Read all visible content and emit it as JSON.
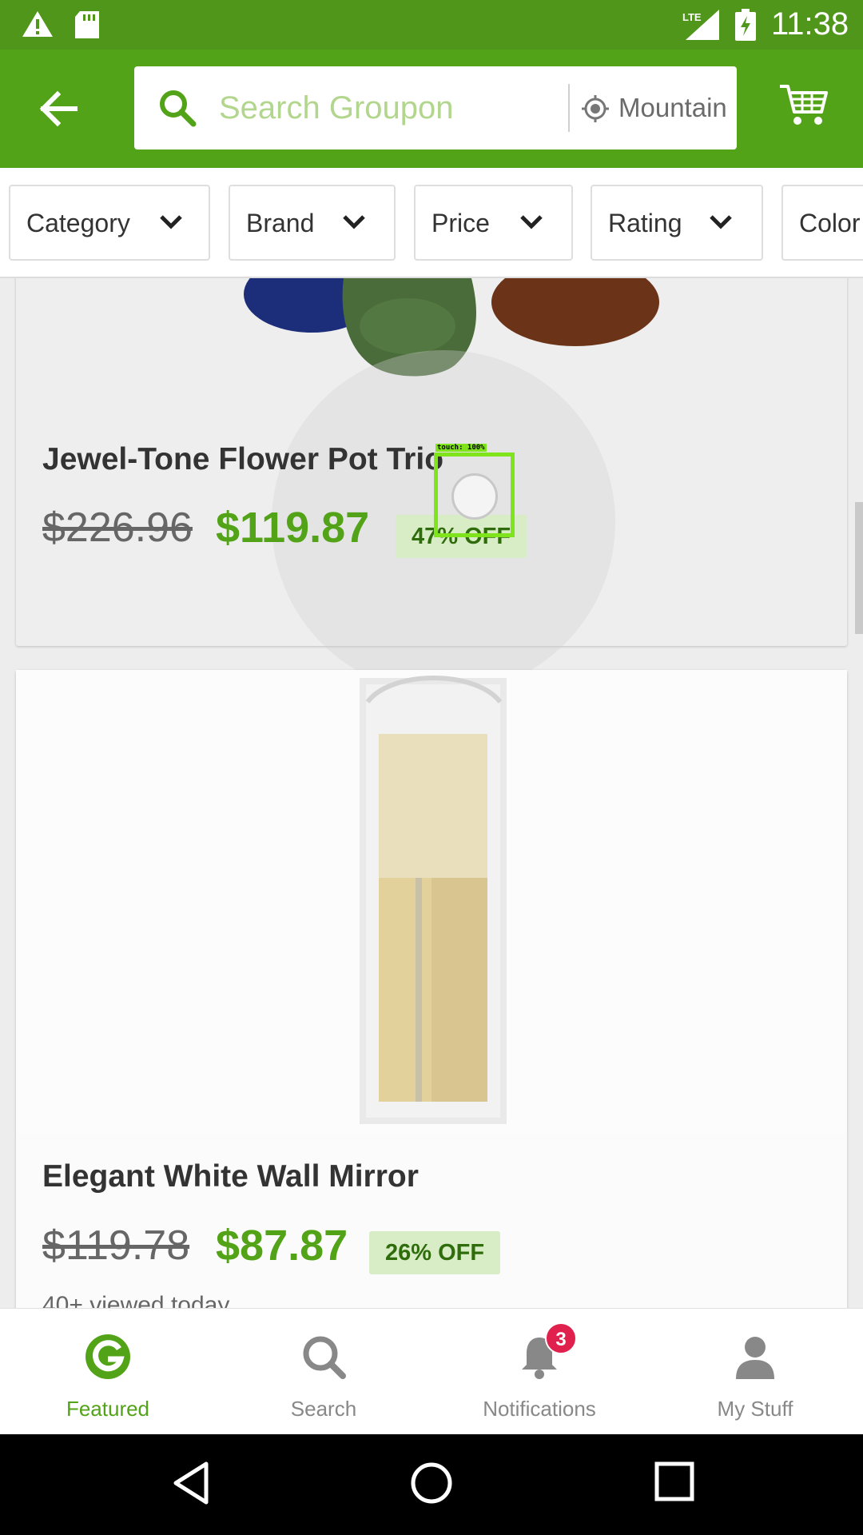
{
  "status_bar": {
    "time": "11:38",
    "network": "LTE",
    "icons": [
      "warning-icon",
      "sd-card-icon",
      "signal-icon",
      "battery-charging-icon"
    ]
  },
  "app_bar": {
    "back_icon": "arrow-left-icon",
    "search_placeholder": "Search Groupon",
    "location": "Mountain",
    "cart_icon": "cart-icon",
    "brand_color": "#53a318"
  },
  "filters": [
    {
      "label": "Category"
    },
    {
      "label": "Brand"
    },
    {
      "label": "Price"
    },
    {
      "label": "Rating"
    },
    {
      "label": "Color"
    }
  ],
  "deals": [
    {
      "title": "Jewel-Tone Flower Pot Trio",
      "old_price": "$226.96",
      "price": "$119.87",
      "discount": "47% OFF"
    },
    {
      "title": "Elegant White Wall Mirror",
      "old_price": "$119.78",
      "price": "$87.87",
      "discount": "26% OFF",
      "viewed": "40+ viewed today"
    }
  ],
  "touch_overlay": {
    "label": "touch: 100%"
  },
  "bottom_nav": [
    {
      "label": "Featured",
      "icon": "groupon-g-icon",
      "active": true
    },
    {
      "label": "Search",
      "icon": "search-icon",
      "active": false
    },
    {
      "label": "Notifications",
      "icon": "bell-icon",
      "active": false,
      "badge": "3"
    },
    {
      "label": "My Stuff",
      "icon": "person-icon",
      "active": false
    }
  ],
  "colors": {
    "accent": "#53a318",
    "price": "#53a318",
    "badge_bg": "#d8ecc6",
    "notification": "#e0204d"
  }
}
